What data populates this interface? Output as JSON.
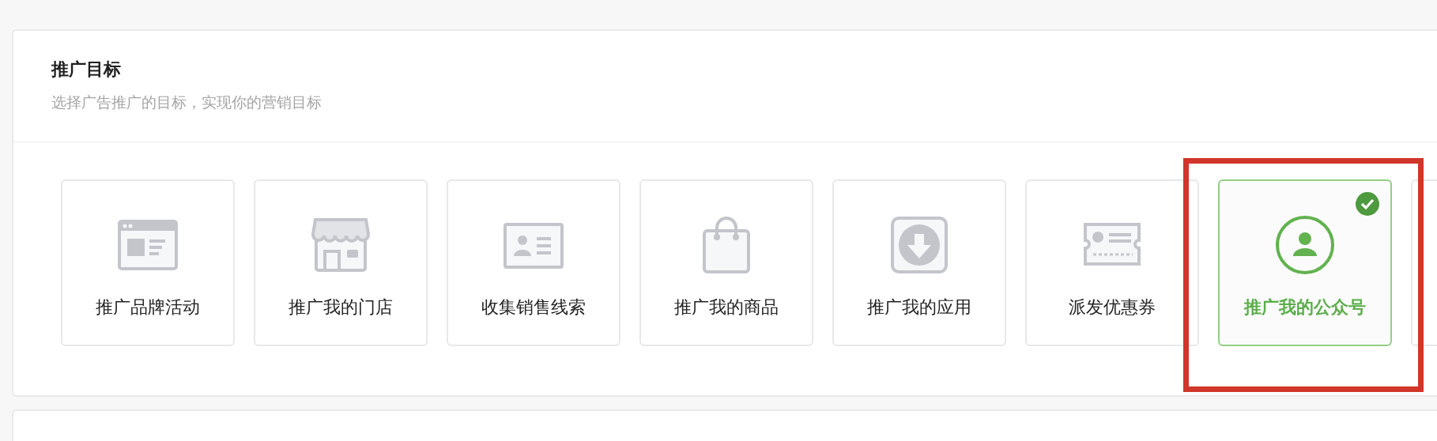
{
  "section": {
    "title": "推广目标",
    "subtitle": "选择广告推广的目标，实现你的营销目标"
  },
  "goals": [
    {
      "kind": "goal",
      "label": "推广品牌活动",
      "selected": false
    },
    {
      "kind": "goal",
      "label": "推广我的门店",
      "selected": false
    },
    {
      "kind": "goal",
      "label": "收集销售线索",
      "selected": false
    },
    {
      "kind": "goal",
      "label": "推广我的商品",
      "selected": false
    },
    {
      "kind": "goal",
      "label": "推广我的应用",
      "selected": false
    },
    {
      "kind": "goal",
      "label": "派发优惠券",
      "selected": false
    },
    {
      "kind": "goal",
      "label": "推广我的公众号",
      "selected": true
    },
    {
      "kind": "cut"
    }
  ],
  "annotation": {
    "kind": "rectangle",
    "color": "#d0362a"
  }
}
